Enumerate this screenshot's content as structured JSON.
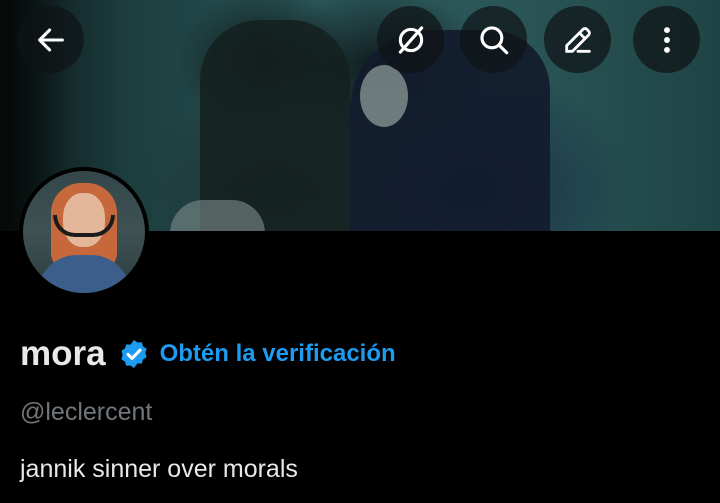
{
  "header": {
    "back_icon": "arrow-left-icon",
    "grok_icon": "grok-icon",
    "search_icon": "search-icon",
    "edit_icon": "pencil-icon",
    "more_icon": "more-vertical-icon"
  },
  "profile": {
    "name": "mora",
    "verified_icon": "verified-badge-icon",
    "get_verified_label": "Obtén la verificación",
    "handle": "@leclercent",
    "bio": "jannik sinner over morals"
  },
  "colors": {
    "background": "#000000",
    "accent": "#1d9bf0",
    "text_primary": "#e7e9ea",
    "text_secondary": "#71767b",
    "button_bg": "#0f1416"
  }
}
